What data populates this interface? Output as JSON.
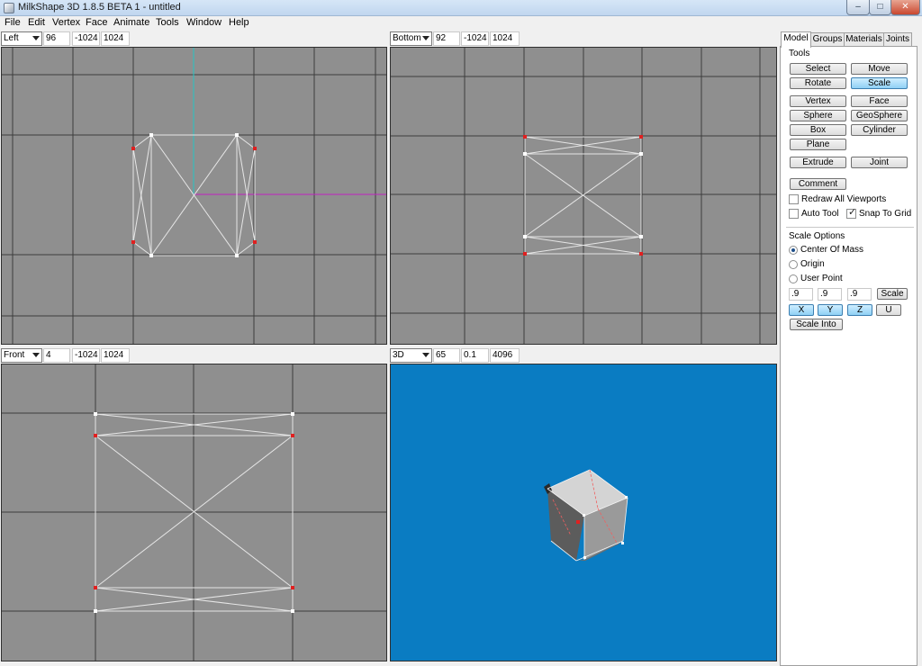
{
  "window": {
    "title": "MilkShape 3D 1.8.5 BETA 1 - untitled",
    "min_glyph": "–",
    "max_glyph": "□",
    "close_glyph": "✕"
  },
  "menu": [
    "File",
    "Edit",
    "Vertex",
    "Face",
    "Animate",
    "Tools",
    "Window",
    "Help"
  ],
  "viewports": {
    "top_left": {
      "view": "Left",
      "zoom": "96",
      "min": "-1024",
      "max": "1024"
    },
    "top_right": {
      "view": "Bottom",
      "zoom": "92",
      "min": "-1024",
      "max": "1024"
    },
    "bottom_left": {
      "view": "Front",
      "zoom": "4",
      "min": "-1024",
      "max": "1024"
    },
    "bottom_right": {
      "view": "3D",
      "zoom": "65",
      "min": "0.1",
      "max": "4096"
    }
  },
  "colors": {
    "viewport_bg": "#8f8f8f",
    "grid": "#3a3a3a",
    "edge": "#e6e6e6",
    "vertex": "#e02020",
    "axis_y": "#20c0c0",
    "axis_x": "#c020c0",
    "view3d_bg": "#0a7cc2",
    "active_button": "#8fd0f5"
  },
  "tabs": [
    "Model",
    "Groups",
    "Materials",
    "Joints"
  ],
  "tools": {
    "heading": "Tools",
    "select": "Select",
    "move": "Move",
    "rotate": "Rotate",
    "scale": "Scale",
    "vertex": "Vertex",
    "face": "Face",
    "sphere": "Sphere",
    "geosphere": "GeoSphere",
    "box": "Box",
    "cylinder": "Cylinder",
    "plane": "Plane",
    "extrude": "Extrude",
    "joint": "Joint",
    "comment": "Comment",
    "active": "Scale"
  },
  "options": {
    "redraw_all": {
      "label": "Redraw All Viewports",
      "checked": false
    },
    "auto_tool": {
      "label": "Auto Tool",
      "checked": false
    },
    "snap_grid": {
      "label": "Snap To Grid",
      "checked": true
    },
    "check_glyph": "✓"
  },
  "scale_options": {
    "heading": "Scale Options",
    "modes": [
      {
        "label": "Center Of Mass",
        "selected": true
      },
      {
        "label": "Origin",
        "selected": false
      },
      {
        "label": "User Point",
        "selected": false
      }
    ],
    "x": ".9",
    "y": ".9",
    "z": ".9",
    "scale_button": "Scale",
    "axes": {
      "x": "X",
      "y": "Y",
      "z": "Z",
      "u": "U"
    },
    "scale_into": "Scale Into"
  }
}
